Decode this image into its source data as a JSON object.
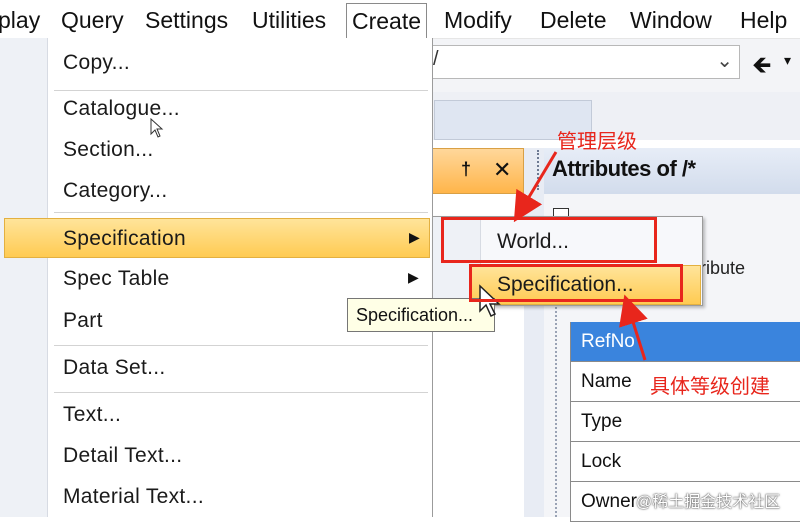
{
  "menubar": {
    "items": [
      "play",
      "Query",
      "Settings",
      "Utilities",
      "Create",
      "Modify",
      "Delete",
      "Window",
      "Help"
    ]
  },
  "toolbar": {
    "combo_value": "/",
    "back_icon": "back-arrow-icon",
    "dropdown_icon": "chevron-down-icon"
  },
  "create_menu": {
    "items": [
      "Copy...",
      "Catalogue...",
      "Section...",
      "Category...",
      "Specification",
      "Spec Table",
      "Part",
      "Data Set...",
      "Text...",
      "Detail Text...",
      "Material Text..."
    ],
    "highlighted": "Specification"
  },
  "submenu": {
    "items": [
      "World...",
      "Specification..."
    ],
    "highlighted": "Specification..."
  },
  "tooltip": {
    "text": "Specification..."
  },
  "attributes_panel": {
    "title": "Attributes of /*",
    "partial_text": "ribute",
    "rows": [
      "RefNo",
      "Name",
      "Type",
      "Lock",
      "Owner"
    ],
    "selected_row": "RefNo"
  },
  "annotations": {
    "top": "管理层级",
    "bottom": "具体等级创建",
    "color": "#e8261c"
  },
  "watermark": "@稀土掘金技术社区",
  "colors": {
    "highlight": "#ffcb52",
    "selection": "#3a84dd",
    "annotation": "#e8261c"
  }
}
